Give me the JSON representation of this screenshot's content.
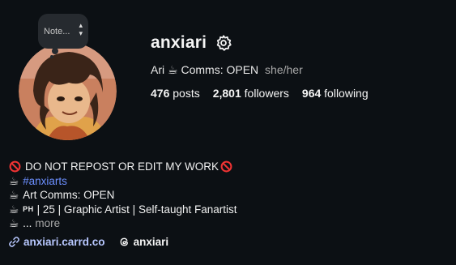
{
  "profile": {
    "username": "anxiari",
    "display_name": "Ari",
    "name_suffix": "Comms: OPEN",
    "pronouns": "she/her",
    "note": "Note..."
  },
  "stats": {
    "posts_count": "476",
    "posts_label": "posts",
    "followers_count": "2,801",
    "followers_label": "followers",
    "following_count": "964",
    "following_label": "following"
  },
  "bio": {
    "line1": "DO NOT REPOST OR EDIT MY WORK",
    "line2": "#anxiarts",
    "line3": "Art Comms: OPEN",
    "line4_tag": "PH",
    "line4": "| 25 | Graphic Artist | Self-taught Fanartist",
    "line5": "...",
    "more_label": "more"
  },
  "links": {
    "website": "anxiari.carrd.co",
    "threads": "anxiari"
  },
  "icons": {
    "settings": "gear-icon",
    "link": "link-icon",
    "threads": "threads-icon",
    "no_entry": "prohibited-emoji-icon",
    "coffee": "hot-beverage-emoji-icon"
  },
  "colors": {
    "background": "#0c1014",
    "hashtag": "#6c8fff",
    "link": "#b8c8ff",
    "muted": "#a8a8a8"
  }
}
